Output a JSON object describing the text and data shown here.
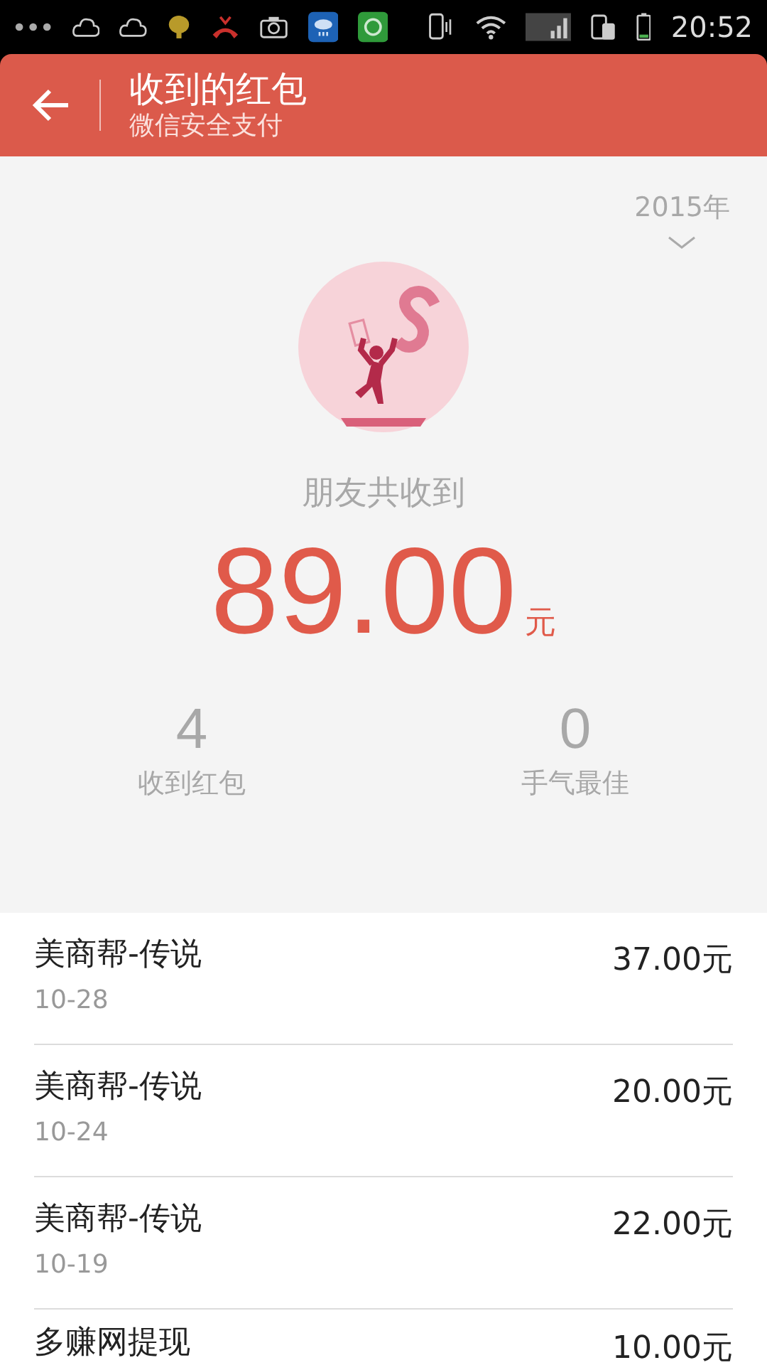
{
  "status_bar": {
    "time": "20:52"
  },
  "header": {
    "title": "收到的红包",
    "subtitle": "微信安全支付"
  },
  "year_selector": {
    "label": "2015年"
  },
  "summary": {
    "caption": "朋友共收到",
    "amount": "89.00",
    "unit": "元"
  },
  "stats": [
    {
      "value": "4",
      "label": "收到红包"
    },
    {
      "value": "0",
      "label": "手气最佳"
    }
  ],
  "records": [
    {
      "name": "美商帮-传说",
      "date": "10-28",
      "amount": "37.00元"
    },
    {
      "name": "美商帮-传说",
      "date": "10-24",
      "amount": "20.00元"
    },
    {
      "name": "美商帮-传说",
      "date": "10-19",
      "amount": "22.00元"
    },
    {
      "name": "多赚网提现",
      "amount": "10.00元"
    }
  ]
}
